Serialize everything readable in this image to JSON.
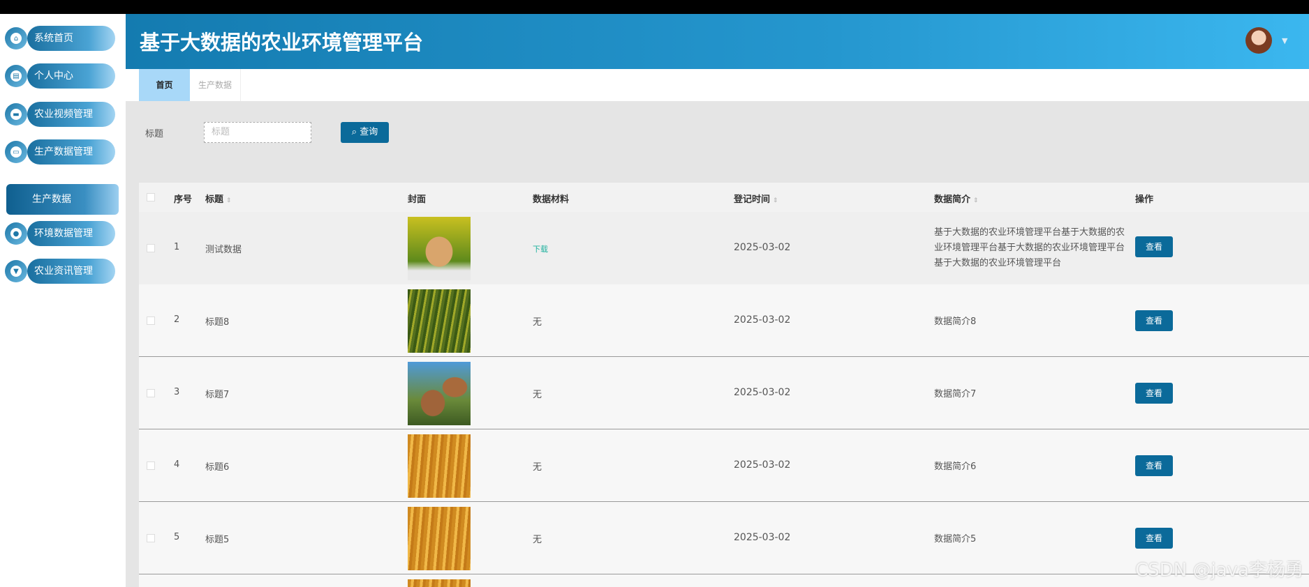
{
  "header": {
    "title": "基于大数据的农业环境管理平台"
  },
  "sidebar": {
    "items": [
      {
        "label": "系统首页",
        "icon": "home-icon"
      },
      {
        "label": "个人中心",
        "icon": "card-icon"
      },
      {
        "label": "农业视频管理",
        "icon": "briefcase-icon"
      },
      {
        "label": "生产数据管理",
        "icon": "monitor-icon"
      },
      {
        "label": "环境数据管理",
        "icon": "user-icon"
      },
      {
        "label": "农业资讯管理",
        "icon": "sign-icon"
      }
    ],
    "active_sub": "生产数据"
  },
  "tabs": [
    {
      "label": "首页",
      "active": true
    },
    {
      "label": "生产数据",
      "active": false
    }
  ],
  "search": {
    "label": "标题",
    "placeholder": "标题",
    "button": "查询"
  },
  "table": {
    "headers": [
      "序号",
      "标题",
      "封面",
      "数据材料",
      "登记时间",
      "数据简介",
      "操作"
    ],
    "rows": [
      {
        "no": "1",
        "title": "测试数据",
        "material": "下载",
        "date": "2025-03-02",
        "intro": "基于大数据的农业环境管理平台基于大数据的农业环境管理平台基于大数据的农业环境管理平台基于大数据的农业环境管理平台",
        "action": "查看",
        "cover": "rabbit"
      },
      {
        "no": "2",
        "title": "标题8",
        "material": "无",
        "date": "2025-03-02",
        "intro": "数据简介8",
        "action": "查看",
        "cover": "millet"
      },
      {
        "no": "3",
        "title": "标题7",
        "material": "无",
        "date": "2025-03-02",
        "intro": "数据简介7",
        "action": "查看",
        "cover": "sorghum"
      },
      {
        "no": "4",
        "title": "标题6",
        "material": "无",
        "date": "2025-03-02",
        "intro": "数据简介6",
        "action": "查看",
        "cover": "wheat"
      },
      {
        "no": "5",
        "title": "标题5",
        "material": "无",
        "date": "2025-03-02",
        "intro": "数据简介5",
        "action": "查看",
        "cover": "wheat"
      }
    ]
  },
  "colors": {
    "primary": "#0b6a9a",
    "link": "#1fb19e"
  },
  "watermark": "CSDN @java李杨勇"
}
